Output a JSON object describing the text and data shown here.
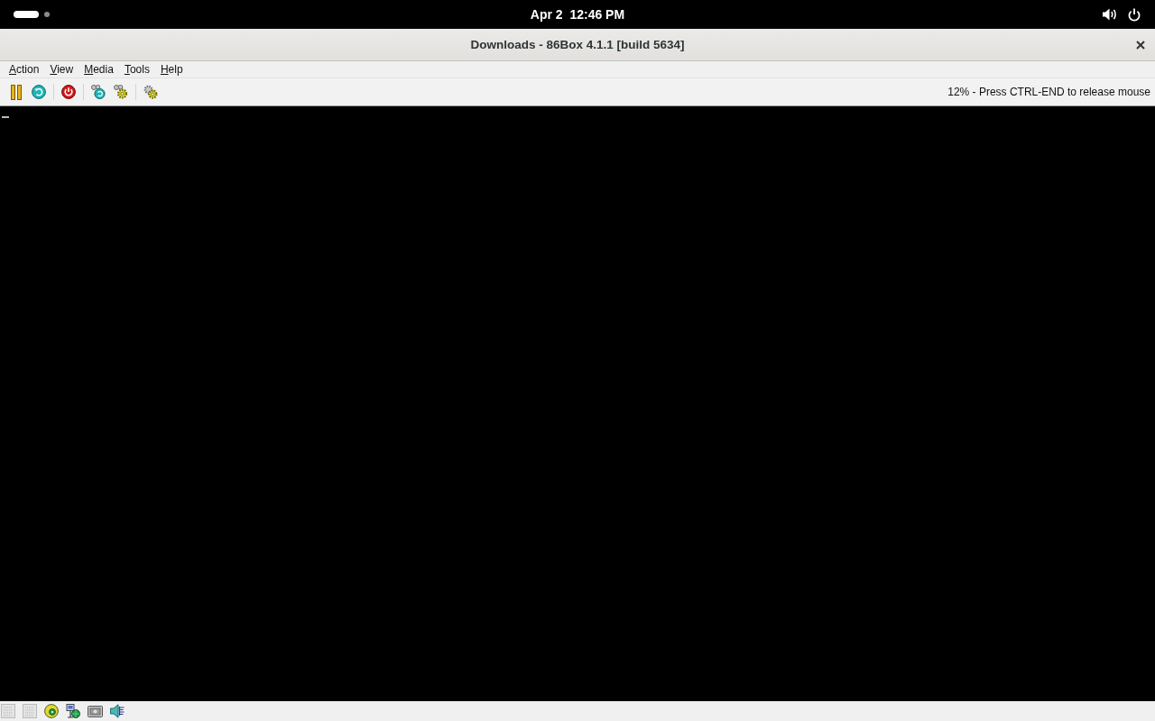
{
  "top_bar": {
    "workspaces": [
      {
        "selected": true
      },
      {
        "selected": false
      }
    ],
    "clock": "Apr 2  12:46 PM"
  },
  "window": {
    "title": "Downloads - 86Box 4.1.1 [build 5634]"
  },
  "menu": [
    {
      "label": "Action",
      "mnemonic": true
    },
    {
      "label": "View",
      "mnemonic": true
    },
    {
      "label": "Media",
      "mnemonic": true
    },
    {
      "label": "Tools",
      "mnemonic": true
    },
    {
      "label": "Help",
      "mnemonic": true
    }
  ],
  "toolbar": {
    "status": "12% - Press CTRL-END to release mouse"
  }
}
